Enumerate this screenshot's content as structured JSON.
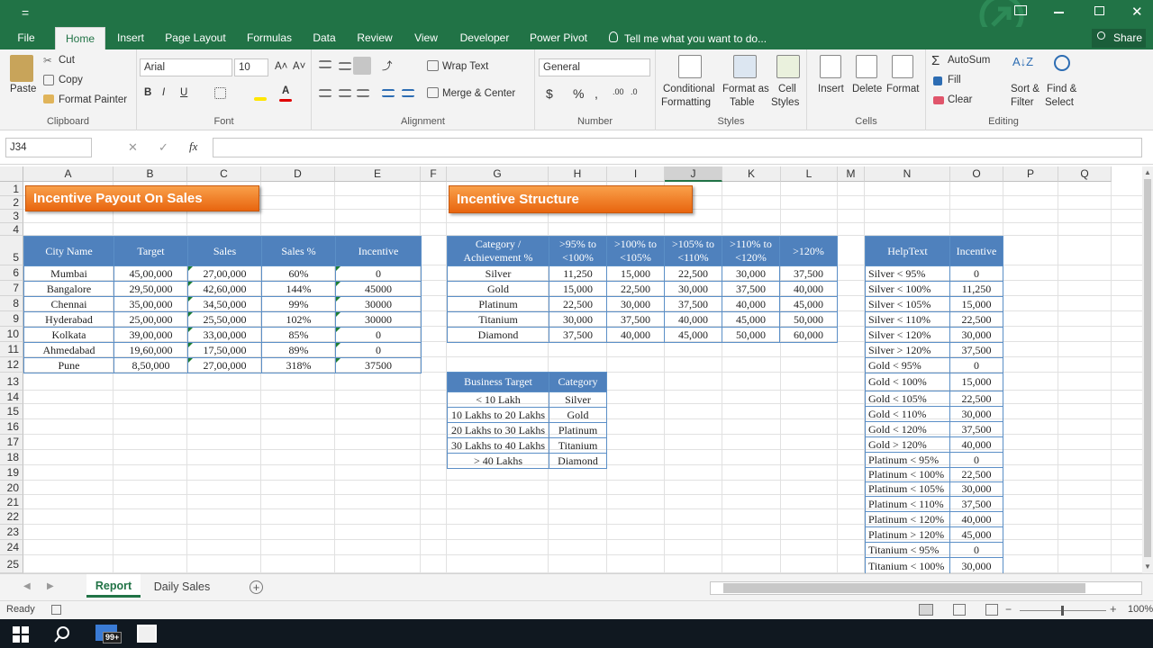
{
  "titlebar": {
    "qat": "="
  },
  "tabs": [
    {
      "label": "File"
    },
    {
      "label": "Home"
    },
    {
      "label": "Insert"
    },
    {
      "label": "Page Layout"
    },
    {
      "label": "Formulas"
    },
    {
      "label": "Data"
    },
    {
      "label": "Review"
    },
    {
      "label": "View"
    },
    {
      "label": "Developer"
    },
    {
      "label": "Power Pivot"
    }
  ],
  "tell_me": "Tell me what you want to do...",
  "share": "Share",
  "clipboard": {
    "paste": "Paste",
    "cut": "Cut",
    "copy": "Copy",
    "format_painter": "Format Painter",
    "label": "Clipboard"
  },
  "font": {
    "name": "Arial",
    "size": "10",
    "label": "Font",
    "bold": "B",
    "italic": "I",
    "underline": "U"
  },
  "alignment": {
    "wrap": "Wrap Text",
    "merge": "Merge & Center",
    "label": "Alignment"
  },
  "number": {
    "format": "General",
    "currency": "$",
    "percent": "%",
    "comma": ",",
    "label": "Number"
  },
  "styles": {
    "conditional": "Conditional",
    "conditional2": "Formatting",
    "format_as": "Format as",
    "format_as2": "Table",
    "cell": "Cell",
    "cell2": "Styles",
    "label": "Styles"
  },
  "cells": {
    "insert": "Insert",
    "delete": "Delete",
    "format": "Format",
    "label": "Cells"
  },
  "editing": {
    "autosum": "AutoSum",
    "fill": "Fill",
    "clear": "Clear",
    "sort": "Sort &",
    "sort2": "Filter",
    "find": "Find &",
    "find2": "Select",
    "label": "Editing"
  },
  "formula_bar": {
    "name_box": "J34",
    "fx": "fx",
    "cancel": "✕",
    "enter": "✓",
    "value": ""
  },
  "columns": [
    "A",
    "B",
    "C",
    "D",
    "E",
    "F",
    "G",
    "H",
    "I",
    "J",
    "K",
    "L",
    "M",
    "N",
    "O",
    "P",
    "Q"
  ],
  "rows": [
    "1",
    "2",
    "3",
    "4",
    "5",
    "6",
    "7",
    "8",
    "9",
    "10",
    "11",
    "12",
    "13",
    "14",
    "15",
    "16",
    "17",
    "18",
    "19",
    "20",
    "21",
    "22",
    "23",
    "24",
    "25"
  ],
  "banner1": "Incentive Payout On Sales",
  "banner2": "Incentive Structure",
  "payout": {
    "headers": [
      "City Name",
      "Target",
      "Sales",
      "Sales %",
      "Incentive"
    ],
    "rows": [
      [
        "Mumbai",
        "45,00,000",
        "27,00,000",
        "60%",
        "0"
      ],
      [
        "Bangalore",
        "29,50,000",
        "42,60,000",
        "144%",
        "45000"
      ],
      [
        "Chennai",
        "35,00,000",
        "34,50,000",
        "99%",
        "30000"
      ],
      [
        "Hyderabad",
        "25,00,000",
        "25,50,000",
        "102%",
        "30000"
      ],
      [
        "Kolkata",
        "39,00,000",
        "33,00,000",
        "85%",
        "0"
      ],
      [
        "Ahmedabad",
        "19,60,000",
        "17,50,000",
        "89%",
        "0"
      ],
      [
        "Pune",
        "8,50,000",
        "27,00,000",
        "318%",
        "37500"
      ]
    ]
  },
  "structure": {
    "headers": [
      "Category / Achievement %",
      ">95% to <100%",
      ">100% to <105%",
      ">105% to <110%",
      ">110% to <120%",
      ">120%"
    ],
    "rows": [
      [
        "Silver",
        "11,250",
        "15,000",
        "22,500",
        "30,000",
        "37,500"
      ],
      [
        "Gold",
        "15,000",
        "22,500",
        "30,000",
        "37,500",
        "40,000"
      ],
      [
        "Platinum",
        "22,500",
        "30,000",
        "37,500",
        "40,000",
        "45,000"
      ],
      [
        "Titanium",
        "30,000",
        "37,500",
        "40,000",
        "45,000",
        "50,000"
      ],
      [
        "Diamond",
        "37,500",
        "40,000",
        "45,000",
        "50,000",
        "60,000"
      ]
    ]
  },
  "target": {
    "headers": [
      "Business Target",
      "Category"
    ],
    "rows": [
      [
        "< 10 Lakh",
        "Silver"
      ],
      [
        "10 Lakhs to 20 Lakhs",
        "Gold"
      ],
      [
        "20 Lakhs to 30 Lakhs",
        "Platinum"
      ],
      [
        "30 Lakhs to 40 Lakhs",
        "Titanium"
      ],
      [
        "> 40 Lakhs",
        "Diamond"
      ]
    ]
  },
  "helptext": {
    "headers": [
      "HelpText",
      "Incentive"
    ],
    "rows": [
      [
        "Silver < 95%",
        "0"
      ],
      [
        "Silver < 100%",
        "11,250"
      ],
      [
        "Silver < 105%",
        "15,000"
      ],
      [
        "Silver < 110%",
        "22,500"
      ],
      [
        "Silver < 120%",
        "30,000"
      ],
      [
        "Silver > 120%",
        "37,500"
      ],
      [
        "Gold < 95%",
        "0"
      ],
      [
        "Gold < 100%",
        "15,000"
      ],
      [
        "Gold < 105%",
        "22,500"
      ],
      [
        "Gold < 110%",
        "30,000"
      ],
      [
        "Gold < 120%",
        "37,500"
      ],
      [
        "Gold > 120%",
        "40,000"
      ],
      [
        "Platinum < 95%",
        "0"
      ],
      [
        "Platinum < 100%",
        "22,500"
      ],
      [
        "Platinum < 105%",
        "30,000"
      ],
      [
        "Platinum < 110%",
        "37,500"
      ],
      [
        "Platinum < 120%",
        "40,000"
      ],
      [
        "Platinum > 120%",
        "45,000"
      ],
      [
        "Titanium < 95%",
        "0"
      ],
      [
        "Titanium < 100%",
        "30,000"
      ]
    ]
  },
  "sheets": [
    "Report",
    "Daily Sales"
  ],
  "status": {
    "ready": "Ready",
    "zoom": "100%"
  },
  "taskbar": {
    "badge": "99+"
  }
}
